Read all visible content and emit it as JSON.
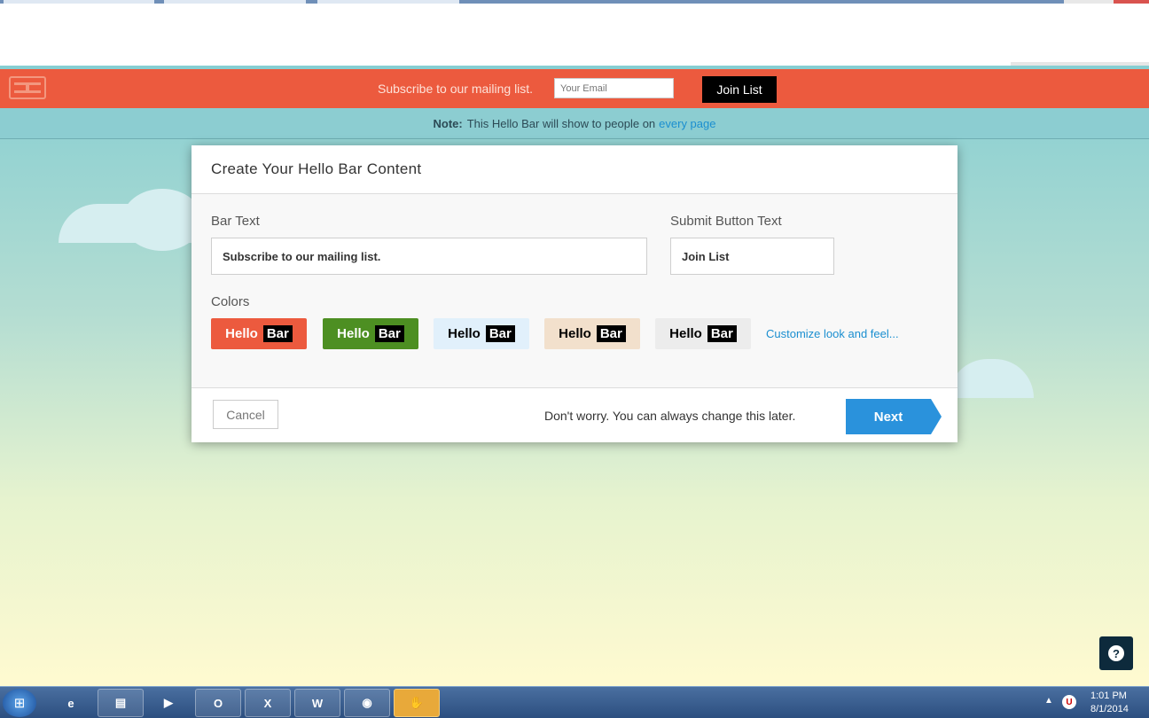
{
  "hellobar": {
    "text": "Subscribe to our mailing list.",
    "email_placeholder": "Your Email",
    "button_label": "Join List",
    "color": "#ec5a3e"
  },
  "note": {
    "label": "Note:",
    "text": "This Hello Bar will show to people on",
    "link": "every page"
  },
  "modal": {
    "title": "Create Your Hello Bar Content",
    "bar_text_label": "Bar Text",
    "bar_text_value": "Subscribe to our mailing list.",
    "submit_label": "Submit Button Text",
    "submit_value": "Join List",
    "colors_label": "Colors",
    "swatches": [
      {
        "hello": "Hello",
        "bar": "Bar",
        "bg": "#ec5a3e",
        "fg": "#ffffff"
      },
      {
        "hello": "Hello",
        "bar": "Bar",
        "bg": "#4d8f22",
        "fg": "#ffffff"
      },
      {
        "hello": "Hello",
        "bar": "Bar",
        "bg": "#e1f0fb",
        "fg": "#000000"
      },
      {
        "hello": "Hello",
        "bar": "Bar",
        "bg": "#f2e0cc",
        "fg": "#000000"
      },
      {
        "hello": "Hello",
        "bar": "Bar",
        "bg": "#ececec",
        "fg": "#000000"
      }
    ],
    "customize_link": "Customize look and feel...",
    "cancel_label": "Cancel",
    "footer_note": "Don't worry. You can always change this later.",
    "next_label": "Next"
  },
  "help": {
    "icon": "question-icon",
    "glyph": "?"
  },
  "taskbar": {
    "start_icon": "windows-start-icon",
    "items": [
      {
        "name": "internet-explorer-icon",
        "glyph": "e"
      },
      {
        "name": "file-explorer-icon",
        "glyph": "▤"
      },
      {
        "name": "media-player-icon",
        "glyph": "▶"
      },
      {
        "name": "outlook-icon",
        "glyph": "O"
      },
      {
        "name": "excel-icon",
        "glyph": "X"
      },
      {
        "name": "word-icon",
        "glyph": "W"
      },
      {
        "name": "chrome-icon",
        "glyph": "◉"
      },
      {
        "name": "handshake-icon",
        "glyph": "✋"
      }
    ],
    "time": "1:01 PM",
    "date": "8/1/2014"
  }
}
